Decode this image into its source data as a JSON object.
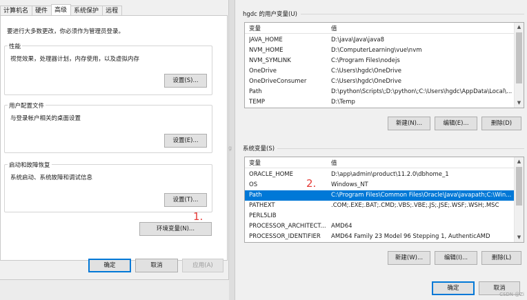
{
  "tabs": [
    {
      "label": "计算机名"
    },
    {
      "label": "硬件"
    },
    {
      "label": "高级"
    },
    {
      "label": "系统保护"
    },
    {
      "label": "远程"
    }
  ],
  "left": {
    "notice": "要进行大多数更改，你必须作为管理员登录。",
    "performance": {
      "title": "性能",
      "desc": "视觉效果，处理器计划，内存使用，以及虚拟内存",
      "button": "设置(S)..."
    },
    "profiles": {
      "title": "用户配置文件",
      "desc": "与登录帐户相关的桌面设置",
      "button": "设置(E)..."
    },
    "startup": {
      "title": "启动和故障恢复",
      "desc": "系统启动、系统故障和调试信息",
      "button": "设置(T)..."
    },
    "env_button": "环境变量(N)...",
    "marker_1": "1.",
    "ok": "确定",
    "cancel": "取消",
    "apply": "应用(A)"
  },
  "user_vars": {
    "label": "hgdc 的用户变量(U)",
    "header_var": "变量",
    "header_val": "值",
    "rows": [
      {
        "name": "JAVA_HOME",
        "value": "D:\\java\\Java\\java8"
      },
      {
        "name": "NVM_HOME",
        "value": "D:\\ComputerLearning\\vue\\nvm"
      },
      {
        "name": "NVM_SYMLINK",
        "value": "C:\\Program Files\\nodejs"
      },
      {
        "name": "OneDrive",
        "value": "C:\\Users\\hgdc\\OneDrive"
      },
      {
        "name": "OneDriveConsumer",
        "value": "C:\\Users\\hgdc\\OneDrive"
      },
      {
        "name": "Path",
        "value": "D:\\python\\Scripts\\;D:\\python\\;C:\\Users\\hgdc\\AppData\\Local\\..."
      },
      {
        "name": "TEMP",
        "value": "D:\\Temp"
      }
    ],
    "new": "新建(N)...",
    "edit": "编辑(E)...",
    "delete": "删除(D)"
  },
  "system_vars": {
    "label": "系统变量(S)",
    "header_var": "变量",
    "header_val": "值",
    "rows": [
      {
        "name": "ORACLE_HOME",
        "value": "D:\\app\\admin\\product\\11.2.0\\dbhome_1"
      },
      {
        "name": "OS",
        "value": "Windows_NT"
      },
      {
        "name": "Path",
        "value": "C:\\Program Files\\Common Files\\Oracle\\Java\\javapath;C:\\Win...",
        "selected": true
      },
      {
        "name": "PATHEXT",
        "value": ".COM;.EXE;.BAT;.CMD;.VBS;.VBE;.JS;.JSE;.WSF;.WSH;.MSC"
      },
      {
        "name": "PERL5LIB",
        "value": ""
      },
      {
        "name": "PROCESSOR_ARCHITECT...",
        "value": "AMD64"
      },
      {
        "name": "PROCESSOR_IDENTIFIER",
        "value": "AMD64 Family 23 Model 96 Stepping 1, AuthenticAMD"
      }
    ],
    "marker_2": "2.",
    "new": "新建(W)...",
    "edit": "编辑(I)...",
    "delete": "删除(L)"
  },
  "dialog": {
    "ok": "确定",
    "cancel": "取消"
  },
  "watermark": "CSDN @Zi"
}
